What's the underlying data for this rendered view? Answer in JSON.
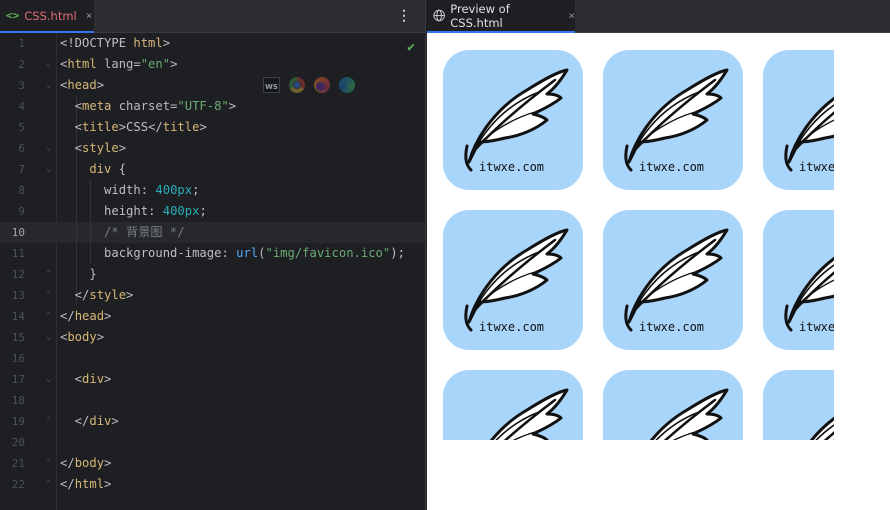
{
  "editor": {
    "tab_title": "CSS.html",
    "tab_icon": "<>",
    "close_glyph": "×",
    "more_glyph": "⋮",
    "check_glyph": "✔",
    "browser_icons": [
      "ws-icon",
      "chrome-icon",
      "firefox-icon",
      "edge-icon"
    ],
    "ws_label": "WS",
    "active_line": 10,
    "lines": [
      {
        "num": "1",
        "fold": "",
        "tokens": [
          [
            "t-punct",
            "<!DOCTYPE "
          ],
          [
            "t-tag",
            "html"
          ],
          [
            "t-punct",
            ">"
          ]
        ]
      },
      {
        "num": "2",
        "fold": "⌄",
        "tokens": [
          [
            "t-punct",
            "<"
          ],
          [
            "t-tag",
            "html "
          ],
          [
            "t-attr",
            "lang="
          ],
          [
            "t-str",
            "\"en\""
          ],
          [
            "t-punct",
            ">"
          ]
        ]
      },
      {
        "num": "3",
        "fold": "⌄",
        "tokens": [
          [
            "t-punct",
            "<"
          ],
          [
            "t-tag",
            "head"
          ],
          [
            "t-punct",
            ">"
          ]
        ]
      },
      {
        "num": "4",
        "fold": "",
        "tokens": [
          [
            "t-punct",
            "  <"
          ],
          [
            "t-tag",
            "meta "
          ],
          [
            "t-attr",
            "charset="
          ],
          [
            "t-str",
            "\"UTF-8\""
          ],
          [
            "t-punct",
            ">"
          ]
        ]
      },
      {
        "num": "5",
        "fold": "",
        "tokens": [
          [
            "t-punct",
            "  <"
          ],
          [
            "t-tag",
            "title"
          ],
          [
            "t-punct",
            ">"
          ],
          [
            "t-text",
            "CSS"
          ],
          [
            "t-punct",
            "</"
          ],
          [
            "t-tag",
            "title"
          ],
          [
            "t-punct",
            ">"
          ]
        ]
      },
      {
        "num": "6",
        "fold": "⌄",
        "tokens": [
          [
            "t-punct",
            "  <"
          ],
          [
            "t-tag",
            "style"
          ],
          [
            "t-punct",
            ">"
          ]
        ]
      },
      {
        "num": "7",
        "fold": "⌄",
        "tokens": [
          [
            "t-sel",
            "    div "
          ],
          [
            "t-punct",
            "{"
          ]
        ]
      },
      {
        "num": "8",
        "fold": "",
        "tokens": [
          [
            "t-prop",
            "      width"
          ],
          [
            "t-punct",
            ": "
          ],
          [
            "t-num",
            "400px"
          ],
          [
            "t-punct",
            ";"
          ]
        ]
      },
      {
        "num": "9",
        "fold": "",
        "tokens": [
          [
            "t-prop",
            "      height"
          ],
          [
            "t-punct",
            ": "
          ],
          [
            "t-num",
            "400px"
          ],
          [
            "t-punct",
            ";"
          ]
        ]
      },
      {
        "num": "10",
        "fold": "",
        "tokens": [
          [
            "t-comment",
            "      /* 背景图 */"
          ]
        ]
      },
      {
        "num": "11",
        "fold": "",
        "tokens": [
          [
            "t-prop",
            "      background-image"
          ],
          [
            "t-punct",
            ": "
          ],
          [
            "t-fn",
            "url"
          ],
          [
            "t-punct",
            "("
          ],
          [
            "t-str",
            "\"img/favicon.ico\""
          ],
          [
            "t-punct",
            ");"
          ]
        ]
      },
      {
        "num": "12",
        "fold": "⌃",
        "tokens": [
          [
            "t-punct",
            "    }"
          ]
        ]
      },
      {
        "num": "13",
        "fold": "⌃",
        "tokens": [
          [
            "t-punct",
            "  </"
          ],
          [
            "t-tag",
            "style"
          ],
          [
            "t-punct",
            ">"
          ]
        ]
      },
      {
        "num": "14",
        "fold": "⌃",
        "tokens": [
          [
            "t-punct",
            "</"
          ],
          [
            "t-tag",
            "head"
          ],
          [
            "t-punct",
            ">"
          ]
        ]
      },
      {
        "num": "15",
        "fold": "⌄",
        "tokens": [
          [
            "t-punct",
            "<"
          ],
          [
            "t-tag",
            "body"
          ],
          [
            "t-punct",
            ">"
          ]
        ]
      },
      {
        "num": "16",
        "fold": "",
        "tokens": []
      },
      {
        "num": "17",
        "fold": "⌄",
        "tokens": [
          [
            "t-punct",
            "  <"
          ],
          [
            "t-tag",
            "div"
          ],
          [
            "t-punct",
            ">"
          ]
        ]
      },
      {
        "num": "18",
        "fold": "",
        "tokens": []
      },
      {
        "num": "19",
        "fold": "⌃",
        "tokens": [
          [
            "t-punct",
            "  </"
          ],
          [
            "t-tag",
            "div"
          ],
          [
            "t-punct",
            ">"
          ]
        ]
      },
      {
        "num": "20",
        "fold": "",
        "tokens": []
      },
      {
        "num": "21",
        "fold": "⌃",
        "tokens": [
          [
            "t-punct",
            "</"
          ],
          [
            "t-tag",
            "body"
          ],
          [
            "t-punct",
            ">"
          ]
        ]
      },
      {
        "num": "22",
        "fold": "⌃",
        "tokens": [
          [
            "t-punct",
            "</"
          ],
          [
            "t-tag",
            "html"
          ],
          [
            "t-punct",
            ">"
          ]
        ]
      }
    ]
  },
  "preview": {
    "tab_title": "Preview of CSS.html",
    "close_glyph": "×",
    "logo_text": "Litwxe.com",
    "tile_color": "#a9d5fb",
    "tile_rows": 3,
    "tile_cols": 3
  }
}
